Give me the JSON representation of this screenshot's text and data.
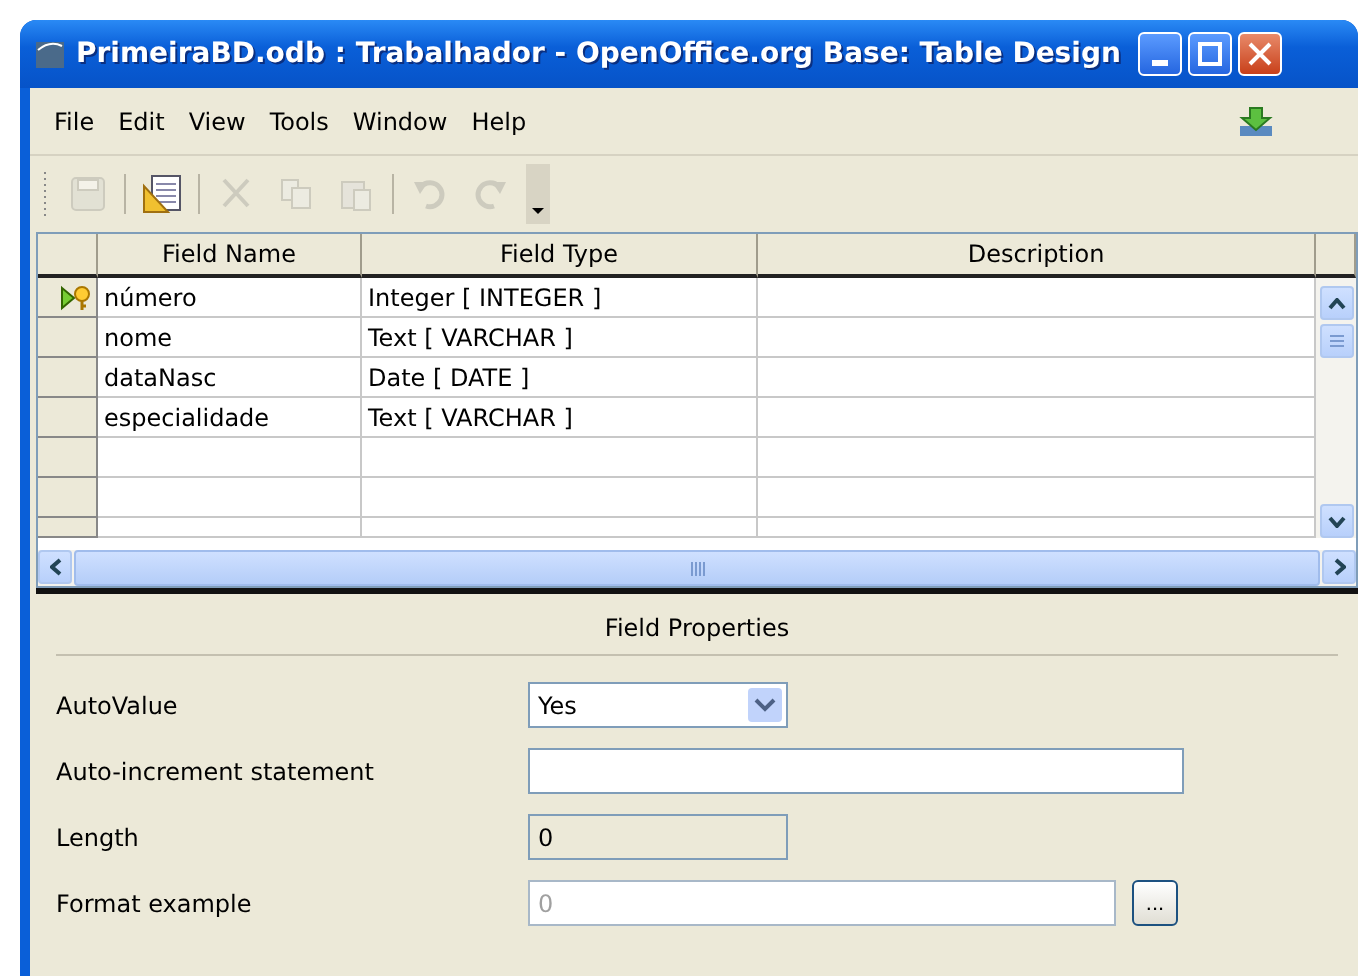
{
  "window": {
    "title": "PrimeiraBD.odb : Trabalhador - OpenOffice.org Base: Table Design"
  },
  "menu": [
    "File",
    "Edit",
    "View",
    "Tools",
    "Window",
    "Help"
  ],
  "toolbar": [
    {
      "kind": "save",
      "disabled": true
    },
    {
      "kind": "separator"
    },
    {
      "kind": "design",
      "disabled": false
    },
    {
      "kind": "separator"
    },
    {
      "kind": "cut",
      "disabled": true
    },
    {
      "kind": "copy",
      "disabled": true
    },
    {
      "kind": "paste",
      "disabled": true
    },
    {
      "kind": "separator"
    },
    {
      "kind": "undo",
      "disabled": true
    },
    {
      "kind": "redo",
      "disabled": true
    }
  ],
  "table": {
    "columns": [
      "Field Name",
      "Field Type",
      "Description"
    ],
    "rows": [
      {
        "name": "número",
        "type": "Integer [ INTEGER ]",
        "description": "",
        "primary_key": true
      },
      {
        "name": "nome",
        "type": "Text [ VARCHAR ]",
        "description": "",
        "primary_key": false
      },
      {
        "name": "dataNasc",
        "type": "Date [ DATE ]",
        "description": "",
        "primary_key": false
      },
      {
        "name": "especialidade",
        "type": "Text [ VARCHAR ]",
        "description": "",
        "primary_key": false
      },
      {
        "name": "",
        "type": "",
        "description": "",
        "primary_key": false
      },
      {
        "name": "",
        "type": "",
        "description": "",
        "primary_key": false
      },
      {
        "name": "",
        "type": "",
        "description": "",
        "primary_key": false
      }
    ]
  },
  "properties": {
    "title": "Field Properties",
    "fields": [
      {
        "kind": "select",
        "label": "AutoValue",
        "value": "Yes",
        "disabled": false
      },
      {
        "kind": "text",
        "label": "Auto-increment statement",
        "disabled": false
      },
      {
        "kind": "readonly",
        "label": "Length",
        "value": "0",
        "disabled": false
      },
      {
        "kind": "browse",
        "label": "Format example",
        "value": "0",
        "disabled": true,
        "button": "..."
      }
    ]
  }
}
